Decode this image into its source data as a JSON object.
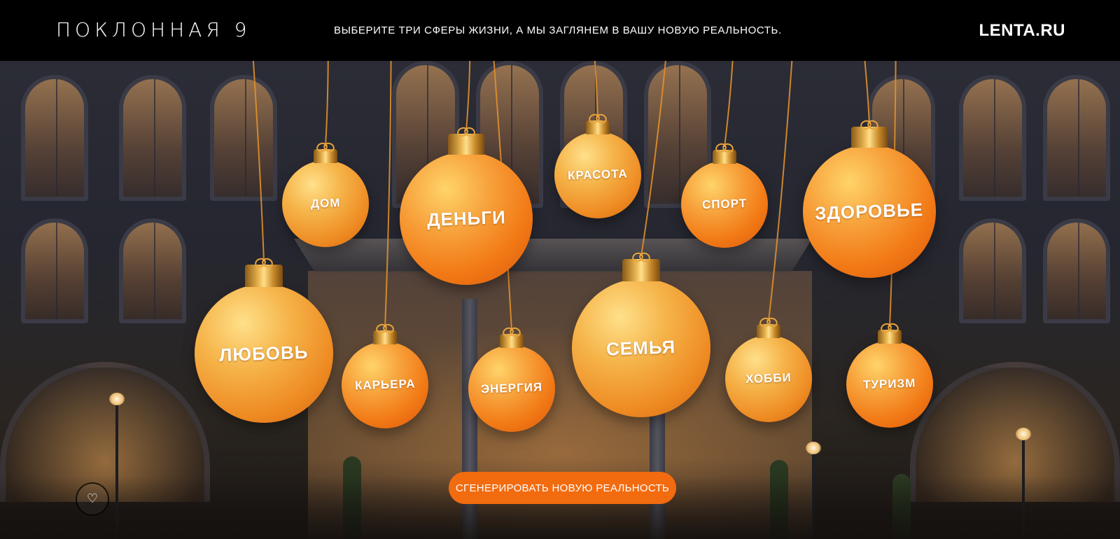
{
  "header": {
    "brand": "ПОКЛОННАЯ 9",
    "tagline": "ВЫБЕРИТЕ ТРИ СФЕРЫ ЖИЗНИ, А МЫ ЗАГЛЯНЕМ В ВАШУ НОВУЮ РЕАЛЬНОСТЬ.",
    "logo": "LENTA.RU"
  },
  "ornaments": [
    {
      "label": "ДОМ",
      "style": "gold"
    },
    {
      "label": "ДЕНЬГИ",
      "style": "orange"
    },
    {
      "label": "КРАСОТА",
      "style": "gold"
    },
    {
      "label": "СПОРТ",
      "style": "orange"
    },
    {
      "label": "ЗДОРОВЬЕ",
      "style": "orange"
    },
    {
      "label": "ЛЮБОВЬ",
      "style": "gold"
    },
    {
      "label": "КАРЬЕРА",
      "style": "orange"
    },
    {
      "label": "ЭНЕРГИЯ",
      "style": "orange"
    },
    {
      "label": "СЕМЬЯ",
      "style": "gold"
    },
    {
      "label": "ХОББИ",
      "style": "gold"
    },
    {
      "label": "ТУРИЗМ",
      "style": "orange"
    }
  ],
  "actions": {
    "generate": "СГЕНЕРИРОВАТЬ НОВУЮ РЕАЛЬНОСТЬ",
    "favorite_icon": "heart-icon"
  },
  "colors": {
    "accent": "#f26b0f",
    "header_bg": "#000000"
  }
}
